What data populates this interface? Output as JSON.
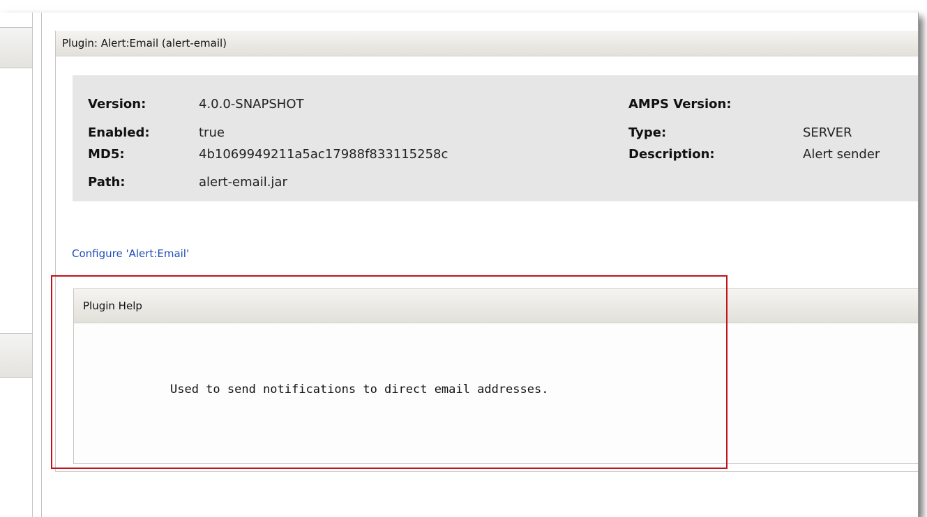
{
  "plugin": {
    "title": "Plugin: Alert:Email (alert-email)",
    "fields": {
      "version_label": "Version:",
      "version_value": "4.0.0-SNAPSHOT",
      "enabled_label": "Enabled:",
      "enabled_value": "true",
      "md5_label": "MD5:",
      "md5_value": "4b1069949211a5ac17988f833115258c",
      "path_label": "Path:",
      "path_value": "alert-email.jar",
      "amps_version_label": "AMPS Version:",
      "amps_version_value": "",
      "type_label": "Type:",
      "type_value": "SERVER",
      "description_label": "Description:",
      "description_value": "Alert sender"
    },
    "configure_link": "Configure 'Alert:Email'"
  },
  "help": {
    "title": "Plugin Help",
    "text": "Used to send notifications to direct email addresses."
  },
  "colors": {
    "link": "#1f4db5",
    "highlight": "#c4121a",
    "info_bg": "#e6e6e6"
  }
}
